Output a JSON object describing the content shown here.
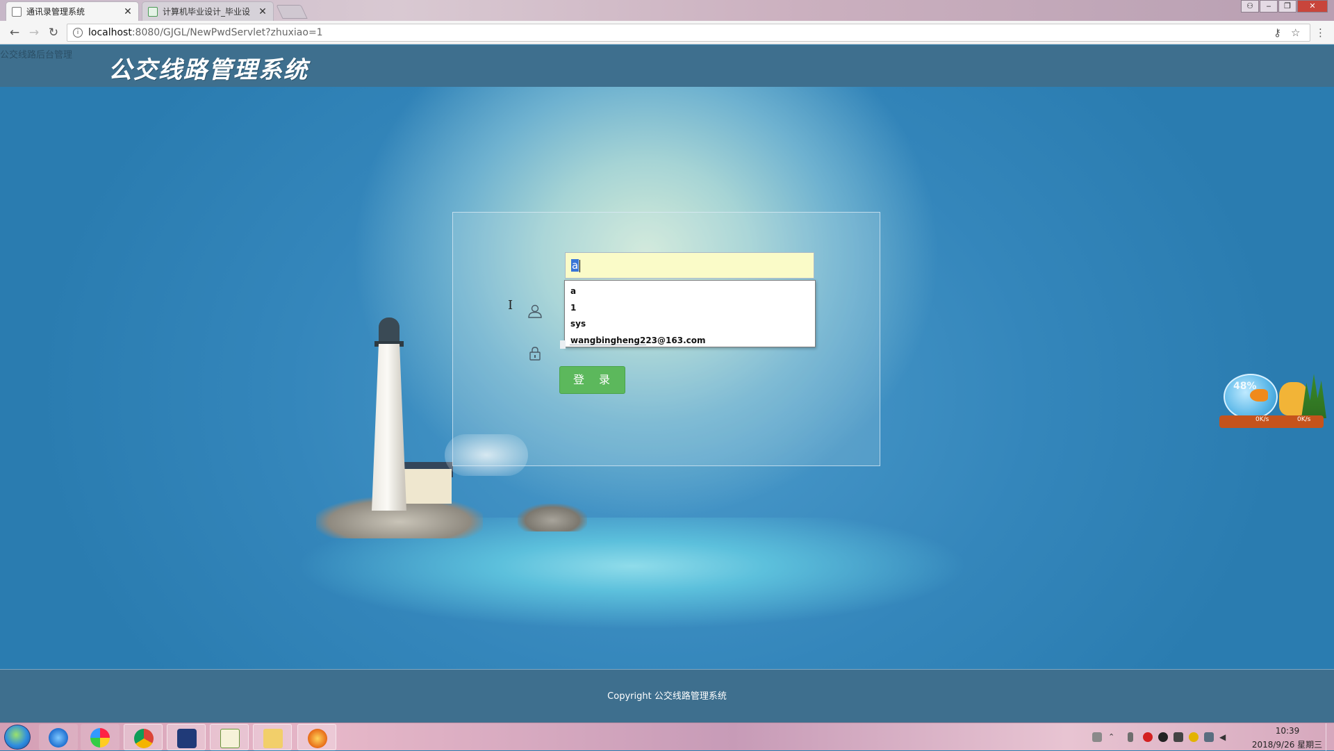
{
  "browser": {
    "tabs": [
      {
        "title": "通讯录管理系统",
        "active": true
      },
      {
        "title": "计算机毕业设计_毕业设",
        "active": false
      }
    ],
    "address": {
      "host": "localhost",
      "rest": ":8080/GJGL/NewPwdServlet?zhuxiao=1"
    }
  },
  "page": {
    "tooltip_text": "公交线路后台管理",
    "logo_title": "公交线路管理系统",
    "login": {
      "username_value": "a",
      "autocomplete": [
        "a",
        "1",
        "sys",
        "wangbingheng223@163.com"
      ],
      "login_button": "登 录"
    },
    "footer": {
      "copyright": "Copyright 公交线路管理系统"
    },
    "net_widget": {
      "percent": "48%",
      "up": "0K/s",
      "down": "0K/s"
    }
  },
  "taskbar": {
    "clock_time": "10:39",
    "clock_date": "2018/9/26 星期三"
  },
  "colors": {
    "header_bg": "#3e6f8e",
    "login_button": "#5cb85c",
    "input_autofill": "#fafbc8"
  }
}
